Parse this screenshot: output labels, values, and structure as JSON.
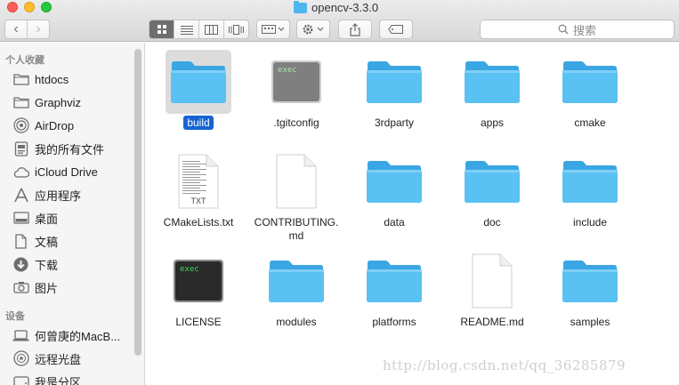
{
  "window": {
    "title": "opencv-3.3.0"
  },
  "toolbar": {
    "back": "‹",
    "forward": "›",
    "search_placeholder": "搜索"
  },
  "sidebar": {
    "favorites_header": "个人收藏",
    "favorites": [
      {
        "label": "htdocs",
        "icon": "folder-icon"
      },
      {
        "label": "Graphviz",
        "icon": "folder-icon"
      },
      {
        "label": "AirDrop",
        "icon": "airdrop-icon"
      },
      {
        "label": "我的所有文件",
        "icon": "all-files-icon"
      },
      {
        "label": "iCloud Drive",
        "icon": "cloud-icon"
      },
      {
        "label": "应用程序",
        "icon": "applications-icon"
      },
      {
        "label": "桌面",
        "icon": "desktop-icon"
      },
      {
        "label": "文稿",
        "icon": "documents-icon"
      },
      {
        "label": "下载",
        "icon": "downloads-icon"
      },
      {
        "label": "图片",
        "icon": "camera-icon"
      }
    ],
    "devices_header": "设备",
    "devices": [
      {
        "label": "何曾庚的MacB...",
        "icon": "laptop-icon"
      },
      {
        "label": "远程光盘",
        "icon": "disc-icon"
      },
      {
        "label": "我是分区",
        "icon": "drive-icon"
      }
    ]
  },
  "files": [
    {
      "name": "build",
      "type": "folder",
      "selected": true
    },
    {
      "name": ".tgitconfig",
      "type": "exec-gray"
    },
    {
      "name": "3rdparty",
      "type": "folder"
    },
    {
      "name": "apps",
      "type": "folder"
    },
    {
      "name": "cmake",
      "type": "folder"
    },
    {
      "name": "CMakeLists.txt",
      "type": "txt",
      "badge": "TXT"
    },
    {
      "name": "CONTRIBUTING.\nmd",
      "type": "doc"
    },
    {
      "name": "data",
      "type": "folder"
    },
    {
      "name": "doc",
      "type": "folder"
    },
    {
      "name": "include",
      "type": "folder"
    },
    {
      "name": "LICENSE",
      "type": "exec-dark"
    },
    {
      "name": "modules",
      "type": "folder"
    },
    {
      "name": "platforms",
      "type": "folder"
    },
    {
      "name": "README.md",
      "type": "doc"
    },
    {
      "name": "samples",
      "type": "folder"
    }
  ],
  "exec_label": "exec",
  "watermark": "http://blog.csdn.net/qq_36285879",
  "colors": {
    "folder": "#5ac1f3",
    "selection": "#1763d3"
  }
}
